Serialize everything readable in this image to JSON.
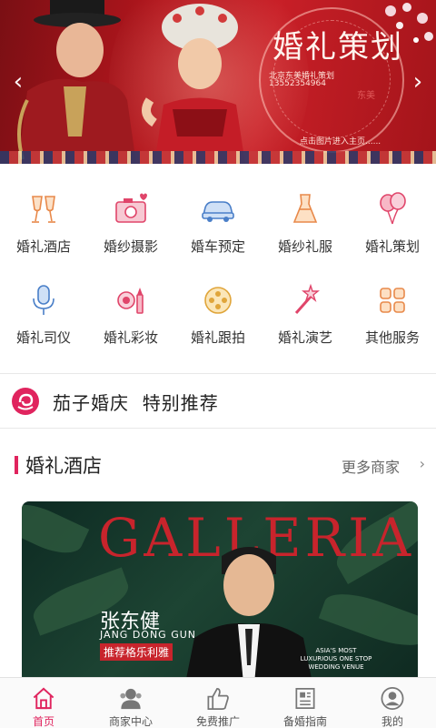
{
  "banner": {
    "title": "婚礼策划",
    "line1": "北京东美婚礼策划",
    "line2": "13552354964",
    "hint": "点击图片进入主页......",
    "seal": "东美"
  },
  "categories": [
    {
      "label": "婚礼酒店",
      "icon": "champagne-icon"
    },
    {
      "label": "婚纱摄影",
      "icon": "camera-icon"
    },
    {
      "label": "婚车预定",
      "icon": "car-icon"
    },
    {
      "label": "婚纱礼服",
      "icon": "dress-icon"
    },
    {
      "label": "婚礼策划",
      "icon": "balloons-icon"
    },
    {
      "label": "婚礼司仪",
      "icon": "microphone-icon"
    },
    {
      "label": "婚礼彩妆",
      "icon": "makeup-icon"
    },
    {
      "label": "婚礼跟拍",
      "icon": "film-reel-icon"
    },
    {
      "label": "婚礼演艺",
      "icon": "magic-wand-icon"
    },
    {
      "label": "其他服务",
      "icon": "grid-icon"
    }
  ],
  "recommend": {
    "text": "茄子婚庆  特别推荐"
  },
  "section": {
    "title": "婚礼酒店",
    "more": "更多商家"
  },
  "card": {
    "magazine": "GALLERIA",
    "name": "张东健",
    "pinyin": "JANG DONG GUN",
    "tag": "推荐格乐利雅",
    "slogan": "ASIA'S MOST LUXURIOUS ONE STOP WEDDING VENUE"
  },
  "nav": [
    {
      "label": "首页",
      "icon": "home-icon",
      "active": true
    },
    {
      "label": "商家中心",
      "icon": "users-icon",
      "active": false
    },
    {
      "label": "免费推广",
      "icon": "thumbs-up-icon",
      "active": false
    },
    {
      "label": "备婚指南",
      "icon": "news-icon",
      "active": false
    },
    {
      "label": "我的",
      "icon": "profile-icon",
      "active": false
    }
  ],
  "colors": {
    "accent": "#e0245e",
    "banner": "#b3161d"
  }
}
